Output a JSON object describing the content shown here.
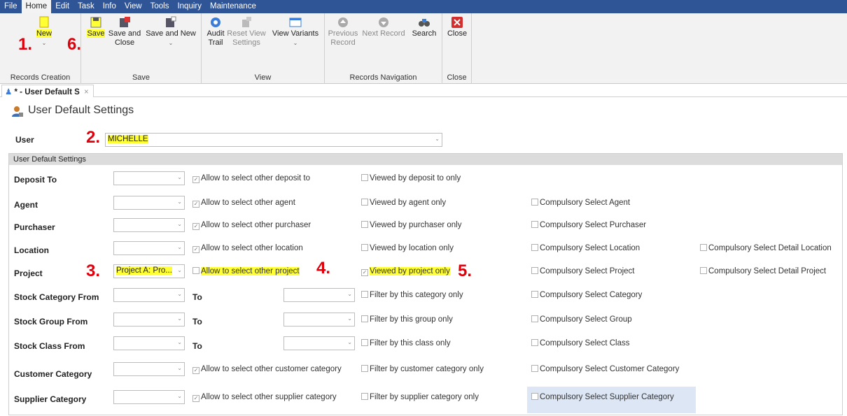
{
  "menu": [
    "File",
    "Home",
    "Edit",
    "Task",
    "Info",
    "View",
    "Tools",
    "Inquiry",
    "Maintenance"
  ],
  "ribbon": {
    "groups": {
      "records_creation": "Records Creation",
      "save": "Save",
      "view": "View",
      "records_navigation": "Records Navigation",
      "close": "Close"
    },
    "buttons": {
      "new": "New",
      "save": "Save",
      "save_and_close_1": "Save and",
      "save_and_close_2": "Close",
      "save_and_new": "Save and New",
      "audit_trail_1": "Audit",
      "audit_trail_2": "Trail",
      "reset_view_1": "Reset View",
      "reset_view_2": "Settings",
      "view_variants": "View Variants",
      "previous_record_1": "Previous",
      "previous_record_2": "Record",
      "next_record": "Next Record",
      "search": "Search",
      "close": "Close"
    }
  },
  "annotations": {
    "a1": "1.",
    "a2": "2.",
    "a3": "3.",
    "a4": "4.",
    "a5": "5.",
    "a6": "6."
  },
  "tab": {
    "label": "* - User Default S",
    "close": "×"
  },
  "page": {
    "title": "User Default Settings",
    "user_label": "User",
    "user_value": "MICHELLE"
  },
  "section": {
    "title": "User Default Settings",
    "to_label": "To",
    "rows": {
      "deposit_to": {
        "label": "Deposit To",
        "c1": "Allow to select other deposit to",
        "c2": "Viewed by deposit to only"
      },
      "agent": {
        "label": "Agent",
        "c1": "Allow to select other agent",
        "c2": "Viewed by agent only",
        "c3": "Compulsory Select Agent"
      },
      "purchaser": {
        "label": "Purchaser",
        "c1": "Allow to select other purchaser",
        "c2": "Viewed by purchaser only",
        "c3": "Compulsory Select Purchaser"
      },
      "location": {
        "label": "Location",
        "c1": "Allow to select other location",
        "c2": "Viewed by location only",
        "c3": "Compulsory Select Location",
        "c4": "Compulsory Select Detail Location"
      },
      "project": {
        "label": "Project",
        "value": "Project A: Pro...",
        "c1": "Allow to select other project",
        "c2": "Viewed by project only",
        "c3": "Compulsory Select Project",
        "c4": "Compulsory Select Detail Project"
      },
      "stock_category": {
        "label": "Stock Category From",
        "c2": "Filter by this category only",
        "c3": "Compulsory Select Category"
      },
      "stock_group": {
        "label": "Stock Group From",
        "c2": "Filter by this group only",
        "c3": "Compulsory Select Group"
      },
      "stock_class": {
        "label": "Stock Class From",
        "c2": "Filter by this class only",
        "c3": "Compulsory Select Class"
      },
      "customer_category": {
        "label": "Customer Category",
        "c1": "Allow to select other customer category",
        "c2": "Filter by customer category only",
        "c3": "Compulsory Select Customer Category"
      },
      "supplier_category": {
        "label": "Supplier Category",
        "c1": "Allow to select other supplier category",
        "c2": "Filter by supplier category only",
        "c3": "Compulsory Select Supplier Category"
      }
    }
  },
  "colors": {
    "menubar": "#2f5597",
    "annotation": "#e0000b",
    "highlight": "#ffff33"
  }
}
